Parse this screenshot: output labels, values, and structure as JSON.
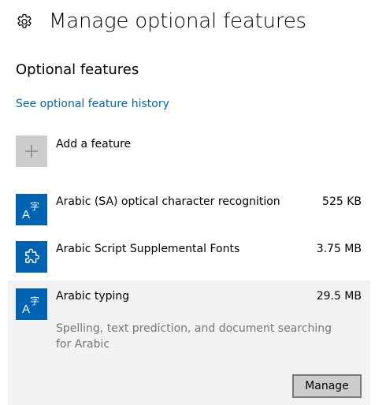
{
  "header": {
    "title": "Manage optional features",
    "icon": "gear-icon"
  },
  "section": {
    "title": "Optional features",
    "history_link": "See optional feature history"
  },
  "add_feature": {
    "label": "Add a feature",
    "icon": "plus-icon"
  },
  "features": [
    {
      "name": "Arabic (SA) optical character recognition",
      "size": "525 KB",
      "icon": "language-icon"
    },
    {
      "name": "Arabic Script Supplemental Fonts",
      "size": "3.75 MB",
      "icon": "puzzle-icon"
    },
    {
      "name": "Arabic typing",
      "size": "29.5 MB",
      "icon": "language-icon",
      "selected": true,
      "description": "Spelling, text prediction, and document searching for Arabic",
      "button_label": "Manage"
    }
  ],
  "colors": {
    "accent": "#0063b1",
    "link": "#0067b8",
    "selected_bg": "#f2f2f2",
    "muted_text": "#767676",
    "add_tile": "#cccccc"
  }
}
